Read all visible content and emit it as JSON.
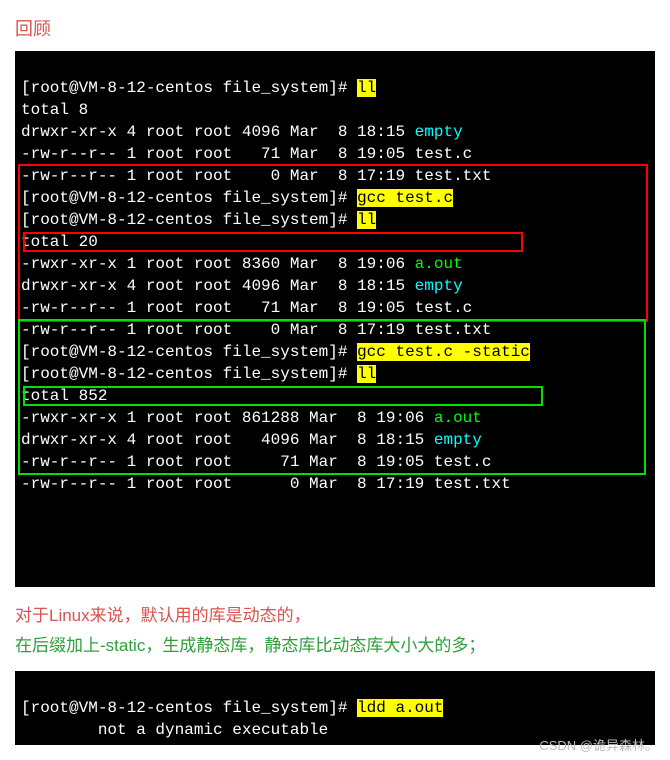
{
  "title": "回顾",
  "term1": {
    "l1_a": "[root@VM-8-12-centos file_system]# ",
    "l1_b": "ll",
    "l2": "total 8",
    "l3_a": "drwxr-xr-x 4 root root 4096 Mar  8 18:15 ",
    "l3_b": "empty",
    "l4": "-rw-r--r-- 1 root root   71 Mar  8 19:05 test.c",
    "l5": "-rw-r--r-- 1 root root    0 Mar  8 17:19 test.txt",
    "l6_a": "[root@VM-8-12-centos file_system]# ",
    "l6_b": "gcc test.c",
    "l7_a": "[root@VM-8-12-centos file_system]# ",
    "l7_b": "ll",
    "l8": "total 20",
    "l9_a": "-rwxr-xr-x 1 root root 8360 Mar  8 19:06 ",
    "l9_b": "a.out",
    "l10_a": "drwxr-xr-x 4 root root 4096 Mar  8 18:15 ",
    "l10_b": "empty",
    "l11": "-rw-r--r-- 1 root root   71 Mar  8 19:05 test.c",
    "l12": "-rw-r--r-- 1 root root    0 Mar  8 17:19 test.txt",
    "l13_a": "[root@VM-8-12-centos file_system]# ",
    "l13_b": "gcc test.c -static",
    "l14_a": "[root@VM-8-12-centos file_system]# ",
    "l14_b": "ll",
    "l15": "total 852",
    "l16_a": "-rwxr-xr-x 1 root root 861288 Mar  8 19:06 ",
    "l16_b": "a.out",
    "l17_a": "drwxr-xr-x 4 root root   4096 Mar  8 18:15 ",
    "l17_b": "empty",
    "l18": "-rw-r--r-- 1 root root     71 Mar  8 19:05 test.c",
    "l19": "-rw-r--r-- 1 root root      0 Mar  8 17:19 test.txt"
  },
  "notes": {
    "red": "对于Linux来说，默认用的库是动态的，",
    "green": "在后缀加上-static，生成静态库，静态库比动态库大小大的多；"
  },
  "term2": {
    "l1_a": "[root@VM-8-12-centos file_system]# ",
    "l1_b": "ldd a.out",
    "l2": "        not a dynamic executable"
  },
  "watermark": "CSDN @诡异森林。"
}
